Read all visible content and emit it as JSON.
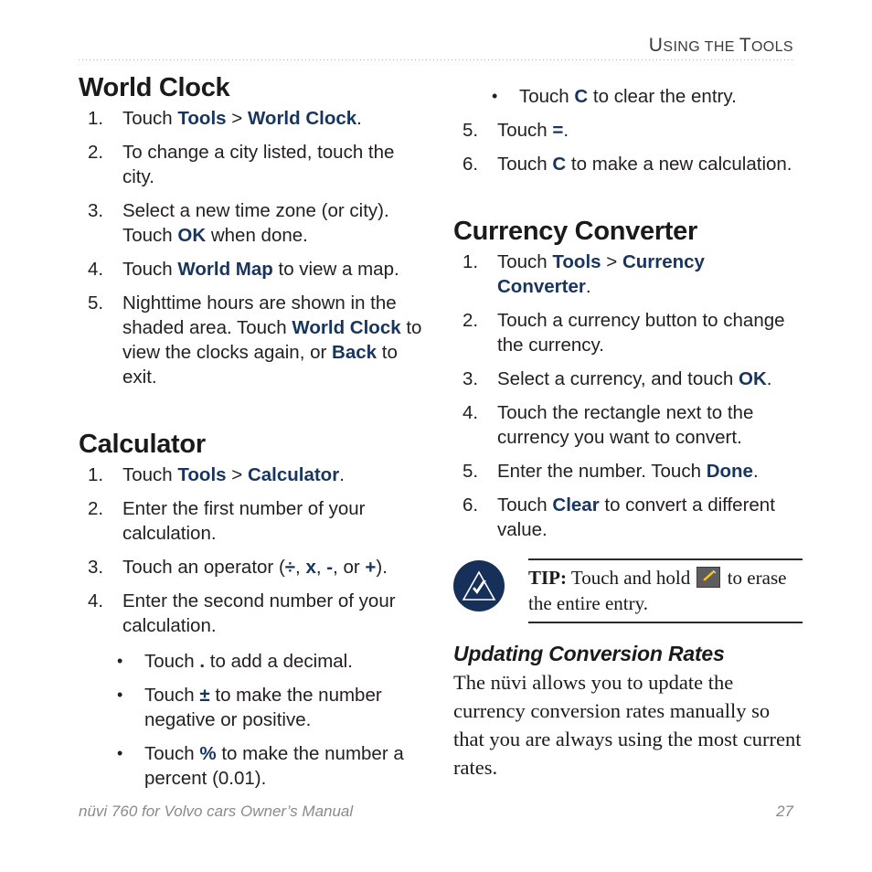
{
  "header": {
    "running_head_first": "U",
    "running_head_rest": "SING THE ",
    "running_head_first2": "T",
    "running_head_rest2": "OOLS",
    "running_head_full": "Using the Tools"
  },
  "left_column": {
    "world_clock": {
      "heading": "World Clock",
      "steps": [
        {
          "num": "1.",
          "parts": [
            {
              "t": "Touch "
            },
            {
              "t": "Tools",
              "b": true
            },
            {
              "t": " > "
            },
            {
              "t": "World Clock",
              "b": true
            },
            {
              "t": "."
            }
          ]
        },
        {
          "num": "2.",
          "parts": [
            {
              "t": "To change a city listed, touch the city."
            }
          ]
        },
        {
          "num": "3.",
          "parts": [
            {
              "t": "Select a new time zone (or city). Touch "
            },
            {
              "t": "OK",
              "b": true
            },
            {
              "t": " when done."
            }
          ]
        },
        {
          "num": "4.",
          "parts": [
            {
              "t": "Touch "
            },
            {
              "t": "World Map",
              "b": true
            },
            {
              "t": " to view a map."
            }
          ]
        },
        {
          "num": "5.",
          "parts": [
            {
              "t": "Nighttime hours are shown in the shaded area. Touch "
            },
            {
              "t": "World Clock",
              "b": true
            },
            {
              "t": " to view the clocks again, or "
            },
            {
              "t": "Back",
              "b": true
            },
            {
              "t": " to exit."
            }
          ]
        }
      ]
    },
    "calculator": {
      "heading": "Calculator",
      "steps": [
        {
          "num": "1.",
          "parts": [
            {
              "t": "Touch "
            },
            {
              "t": "Tools",
              "b": true
            },
            {
              "t": " > "
            },
            {
              "t": "Calculator",
              "b": true
            },
            {
              "t": "."
            }
          ]
        },
        {
          "num": "2.",
          "parts": [
            {
              "t": "Enter the first number of your calculation."
            }
          ]
        },
        {
          "num": "3.",
          "parts": [
            {
              "t": "Touch an operator ("
            },
            {
              "t": "÷",
              "b": true
            },
            {
              "t": ", "
            },
            {
              "t": "x",
              "b": true
            },
            {
              "t": ", "
            },
            {
              "t": "-",
              "b": true
            },
            {
              "t": ", or "
            },
            {
              "t": "+",
              "b": true
            },
            {
              "t": ")."
            }
          ]
        },
        {
          "num": "4.",
          "parts": [
            {
              "t": "Enter the second number of your calculation."
            }
          ]
        }
      ],
      "bullets": [
        {
          "marker": "•",
          "parts": [
            {
              "t": "Touch "
            },
            {
              "t": ".",
              "b": true
            },
            {
              "t": " to add a decimal."
            }
          ]
        },
        {
          "marker": "•",
          "parts": [
            {
              "t": "Touch "
            },
            {
              "t": "±",
              "b": true
            },
            {
              "t": " to make the number negative or positive."
            }
          ]
        },
        {
          "marker": "•",
          "parts": [
            {
              "t": "Touch "
            },
            {
              "t": "%",
              "b": true
            },
            {
              "t": " to make the number a percent (0.01)."
            }
          ]
        }
      ]
    }
  },
  "right_column": {
    "calculator_cont": {
      "bullets": [
        {
          "marker": "•",
          "parts": [
            {
              "t": "Touch "
            },
            {
              "t": "C",
              "b": true
            },
            {
              "t": " to clear the entry."
            }
          ]
        }
      ],
      "steps": [
        {
          "num": "5.",
          "parts": [
            {
              "t": "Touch "
            },
            {
              "t": "=",
              "b": true
            },
            {
              "t": "."
            }
          ]
        },
        {
          "num": "6.",
          "parts": [
            {
              "t": "Touch "
            },
            {
              "t": "C",
              "b": true
            },
            {
              "t": " to make a new calculation."
            }
          ]
        }
      ]
    },
    "currency_converter": {
      "heading": "Currency Converter",
      "steps": [
        {
          "num": "1.",
          "parts": [
            {
              "t": "Touch "
            },
            {
              "t": "Tools",
              "b": true
            },
            {
              "t": " > "
            },
            {
              "t": "Currency Converter",
              "b": true
            },
            {
              "t": "."
            }
          ]
        },
        {
          "num": "2.",
          "parts": [
            {
              "t": "Touch a currency button to change the currency."
            }
          ]
        },
        {
          "num": "3.",
          "parts": [
            {
              "t": "Select a currency, and touch "
            },
            {
              "t": "OK",
              "b": true
            },
            {
              "t": "."
            }
          ]
        },
        {
          "num": "4.",
          "parts": [
            {
              "t": "Touch the rectangle next to the currency you want to convert."
            }
          ]
        },
        {
          "num": "5.",
          "parts": [
            {
              "t": "Enter the number. Touch "
            },
            {
              "t": "Done",
              "b": true
            },
            {
              "t": "."
            }
          ]
        },
        {
          "num": "6.",
          "parts": [
            {
              "t": "Touch "
            },
            {
              "t": "Clear",
              "b": true
            },
            {
              "t": " to convert a different value."
            }
          ]
        }
      ]
    },
    "tip": {
      "icon_name": "note-check-triangle-icon",
      "label": "TIP:",
      "text_before": " Touch and hold ",
      "inline_icon_name": "eraser-pencil-icon",
      "text_after": " to erase the entire entry."
    },
    "updating_rates": {
      "heading": "Updating Conversion Rates",
      "body": "The nüvi allows you to update the currency conversion rates manually so that you are always using the most current rates."
    }
  },
  "footer": {
    "left": "nüvi 760 for Volvo cars Owner’s Manual",
    "page": "27"
  },
  "colors": {
    "accent_navy": "#18355e",
    "tip_circle": "#16305a",
    "body_text": "#231f20",
    "footer_text": "#8a8a8a",
    "rule_dotted": "#b4b4b4"
  }
}
